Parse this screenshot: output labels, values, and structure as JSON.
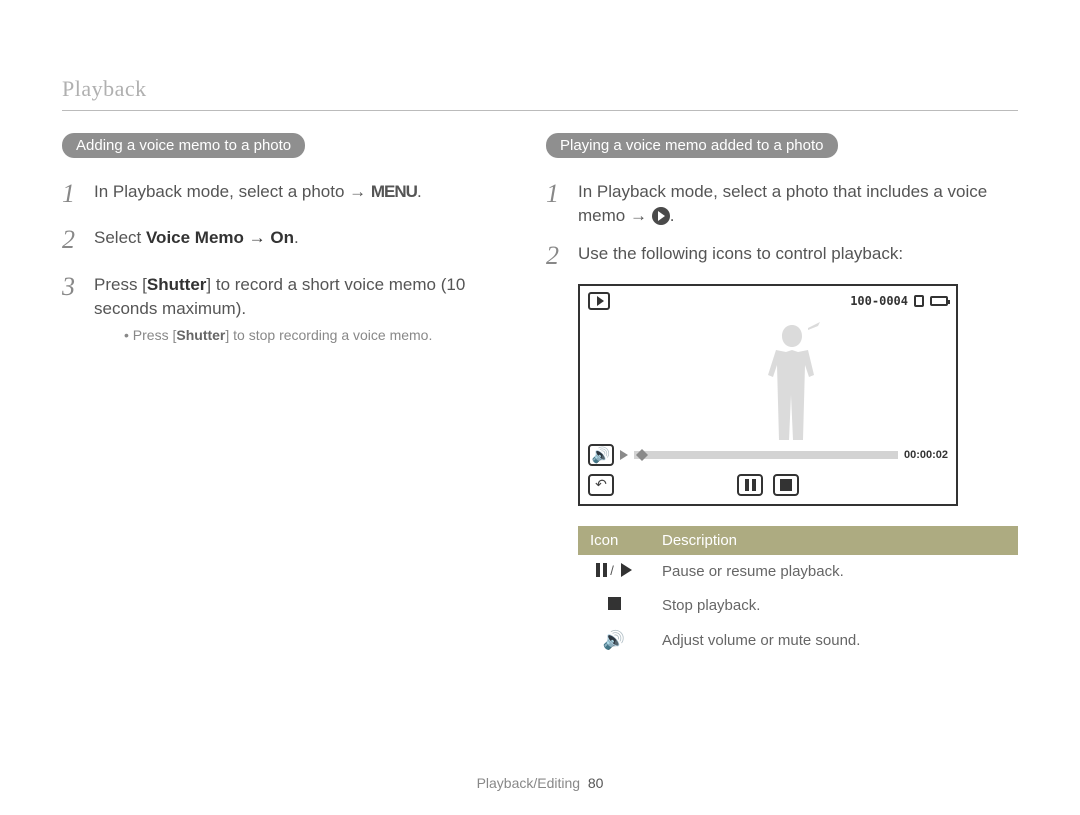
{
  "page": {
    "header": "Playback",
    "footer_section": "Playback/Editing",
    "footer_page": "80"
  },
  "left": {
    "title": "Adding a voice memo to a photo",
    "steps": [
      {
        "num": "1",
        "text_pre": "In Playback mode, select a photo → ",
        "menu": "MENU",
        "text_post": "."
      },
      {
        "num": "2",
        "text_pre": "Select ",
        "bold": "Voice Memo → On",
        "text_post": "."
      },
      {
        "num": "3",
        "text_pre": "Press [",
        "bold": "Shutter",
        "text_post": "] to record a short voice memo (10 seconds maximum)."
      }
    ],
    "sub_bullet_pre": "Press [",
    "sub_bullet_bold": "Shutter",
    "sub_bullet_post": "] to stop recording a voice memo."
  },
  "right": {
    "title": "Playing a voice memo added to a photo",
    "step1_pre": "In Playback mode, select a photo that includes a voice memo → ",
    "step2": "Use the following icons to control playback:",
    "screen": {
      "file_number": "100-0004",
      "time": "00:00:02"
    },
    "table": {
      "headers": {
        "icon": "Icon",
        "desc": "Description"
      },
      "rows": [
        {
          "desc": "Pause or resume playback."
        },
        {
          "desc": "Stop playback."
        },
        {
          "desc": "Adjust volume or mute sound."
        }
      ]
    }
  }
}
